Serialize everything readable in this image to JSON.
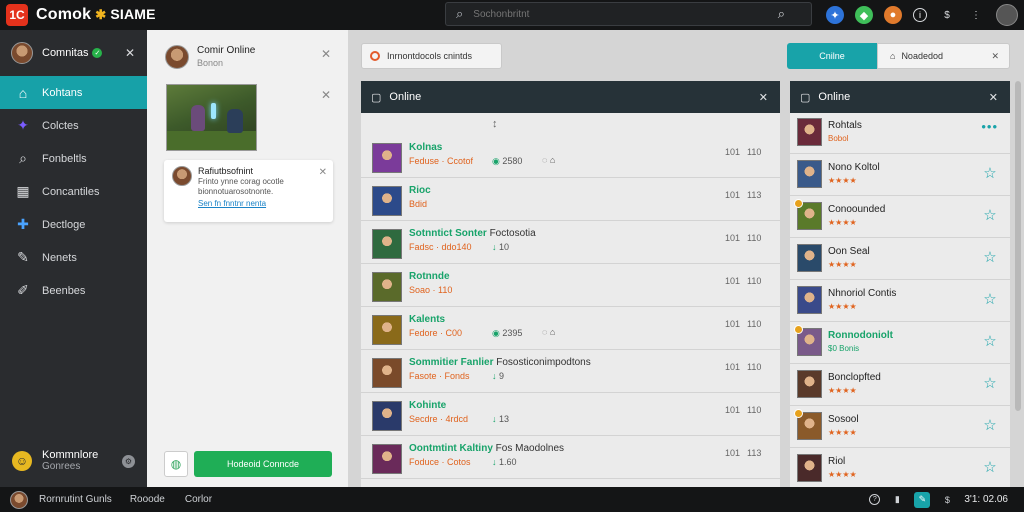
{
  "app": {
    "logo_text": "1C",
    "brand": "Comok",
    "brand_sub": "SIAME"
  },
  "search": {
    "placeholder": "Sochonbritnt"
  },
  "sidebar": {
    "user": {
      "name": "Comnitas"
    },
    "items": [
      {
        "label": "Kohtans",
        "icon": "home-icon",
        "active": true
      },
      {
        "label": "Colctes",
        "icon": "game-icon",
        "active": false
      },
      {
        "label": "Fonbeltls",
        "icon": "search-icon",
        "active": false
      },
      {
        "label": "Concantiles",
        "icon": "grid-icon",
        "active": false
      },
      {
        "label": "Dectloge",
        "icon": "puzzle-icon",
        "active": false
      },
      {
        "label": "Nenets",
        "icon": "pen-icon",
        "active": false
      },
      {
        "label": "Beenbes",
        "icon": "brush-icon",
        "active": false
      }
    ],
    "footer": {
      "title": "Kommnlore",
      "subtitle": "Gonrees"
    }
  },
  "chat": {
    "header": {
      "title": "Comir Online",
      "subtitle": "Bonon"
    },
    "card": {
      "title": "Rafiutbsofnint",
      "line1": "Frinto ynne corag ocotle",
      "line2": "bionnotuarosotnonte.",
      "link": "Sen fn fnntnr nenta"
    },
    "footer_button": "Hodeoid Conncde"
  },
  "toolbar": {
    "filter_text": "Inrnontdocols cnintds",
    "seg_on": "Cnilne",
    "seg_off": "Noadedod"
  },
  "main_panel": {
    "title": "Online"
  },
  "games": [
    {
      "name": "Kolnas",
      "ext": "",
      "sub": "Feduse · Ccotof",
      "views": "2580",
      "ch": "",
      "m1": "101",
      "m2": "110",
      "color": "#7b3b9a"
    },
    {
      "name": "Rioc",
      "ext": "",
      "sub": "Bdid",
      "views": "",
      "ch": "",
      "m1": "101",
      "m2": "113",
      "color": "#2c4a8a"
    },
    {
      "name": "Sotnntict Sonter",
      "ext": "Foctosotia",
      "sub": "Fadsc · ddo140",
      "views": "",
      "ch": "10",
      "m1": "101",
      "m2": "110",
      "color": "#2f6a3f"
    },
    {
      "name": "Rotnnde",
      "ext": "",
      "sub": "Soao · 110",
      "views": "",
      "ch": "",
      "m1": "101",
      "m2": "110",
      "color": "#5a6a2a"
    },
    {
      "name": "Kalents",
      "ext": "",
      "sub": "Fedore · C00",
      "views": "2395",
      "ch": "",
      "m1": "101",
      "m2": "110",
      "color": "#8a6a1a"
    },
    {
      "name": "Sommitier Fanlier",
      "ext": "Fososticonimpodtons",
      "sub": "Fasote · Fonds",
      "views": "",
      "ch": "9",
      "m1": "101",
      "m2": "110",
      "color": "#7a4a2a"
    },
    {
      "name": "Kohinte",
      "ext": "",
      "sub": "Secdre · 4rdcd",
      "views": "",
      "ch": "13",
      "m1": "101",
      "m2": "110",
      "color": "#2a3a6a"
    },
    {
      "name": "Oontmtint Kaltiny",
      "ext": "Fos Maodolnes",
      "sub": "Foduce · Cotos",
      "views": "",
      "ch": "1.60",
      "m1": "101",
      "m2": "113",
      "color": "#6a2a5a"
    }
  ],
  "friends_panel": {
    "title": "Online"
  },
  "friends": [
    {
      "name": "Rohtals",
      "sub": "Bobol",
      "green": false,
      "badge": false,
      "action": "more",
      "color": "#6a2a3a"
    },
    {
      "name": "Nono Koltol",
      "sub": "★★★★",
      "green": false,
      "badge": false,
      "action": "star",
      "color": "#3a5a8a"
    },
    {
      "name": "Conoounded",
      "sub": "★★★★",
      "green": false,
      "badge": true,
      "action": "star",
      "color": "#5a7a2a"
    },
    {
      "name": "Oon Seal",
      "sub": "★★★★",
      "green": false,
      "badge": false,
      "action": "star",
      "color": "#2a4a6a"
    },
    {
      "name": "Nhnoriol Contis",
      "sub": "★★★★",
      "green": false,
      "badge": false,
      "action": "star",
      "color": "#3a4a8a"
    },
    {
      "name": "Ronnodoniolt",
      "sub": "$0 Bonis",
      "green": true,
      "badge": true,
      "action": "star",
      "color": "#7a5a8a"
    },
    {
      "name": "Bonclopfted",
      "sub": "★★★★",
      "green": false,
      "badge": false,
      "action": "star",
      "color": "#5a3a2a"
    },
    {
      "name": "Sosool",
      "sub": "★★★★",
      "green": false,
      "badge": true,
      "action": "star",
      "color": "#8a5a2a"
    },
    {
      "name": "Riol",
      "sub": "★★★★",
      "green": false,
      "badge": false,
      "action": "star",
      "color": "#4a2a2a"
    }
  ],
  "bottombar": {
    "label1": "Rornrutint Gunls",
    "label2": "Rooode",
    "label3": "Corlor",
    "time": "3'1: 02.06"
  },
  "colors": {
    "accent": "#18a3a9",
    "green": "#1fae56",
    "orange": "#e0631e",
    "dark": "#141516"
  }
}
